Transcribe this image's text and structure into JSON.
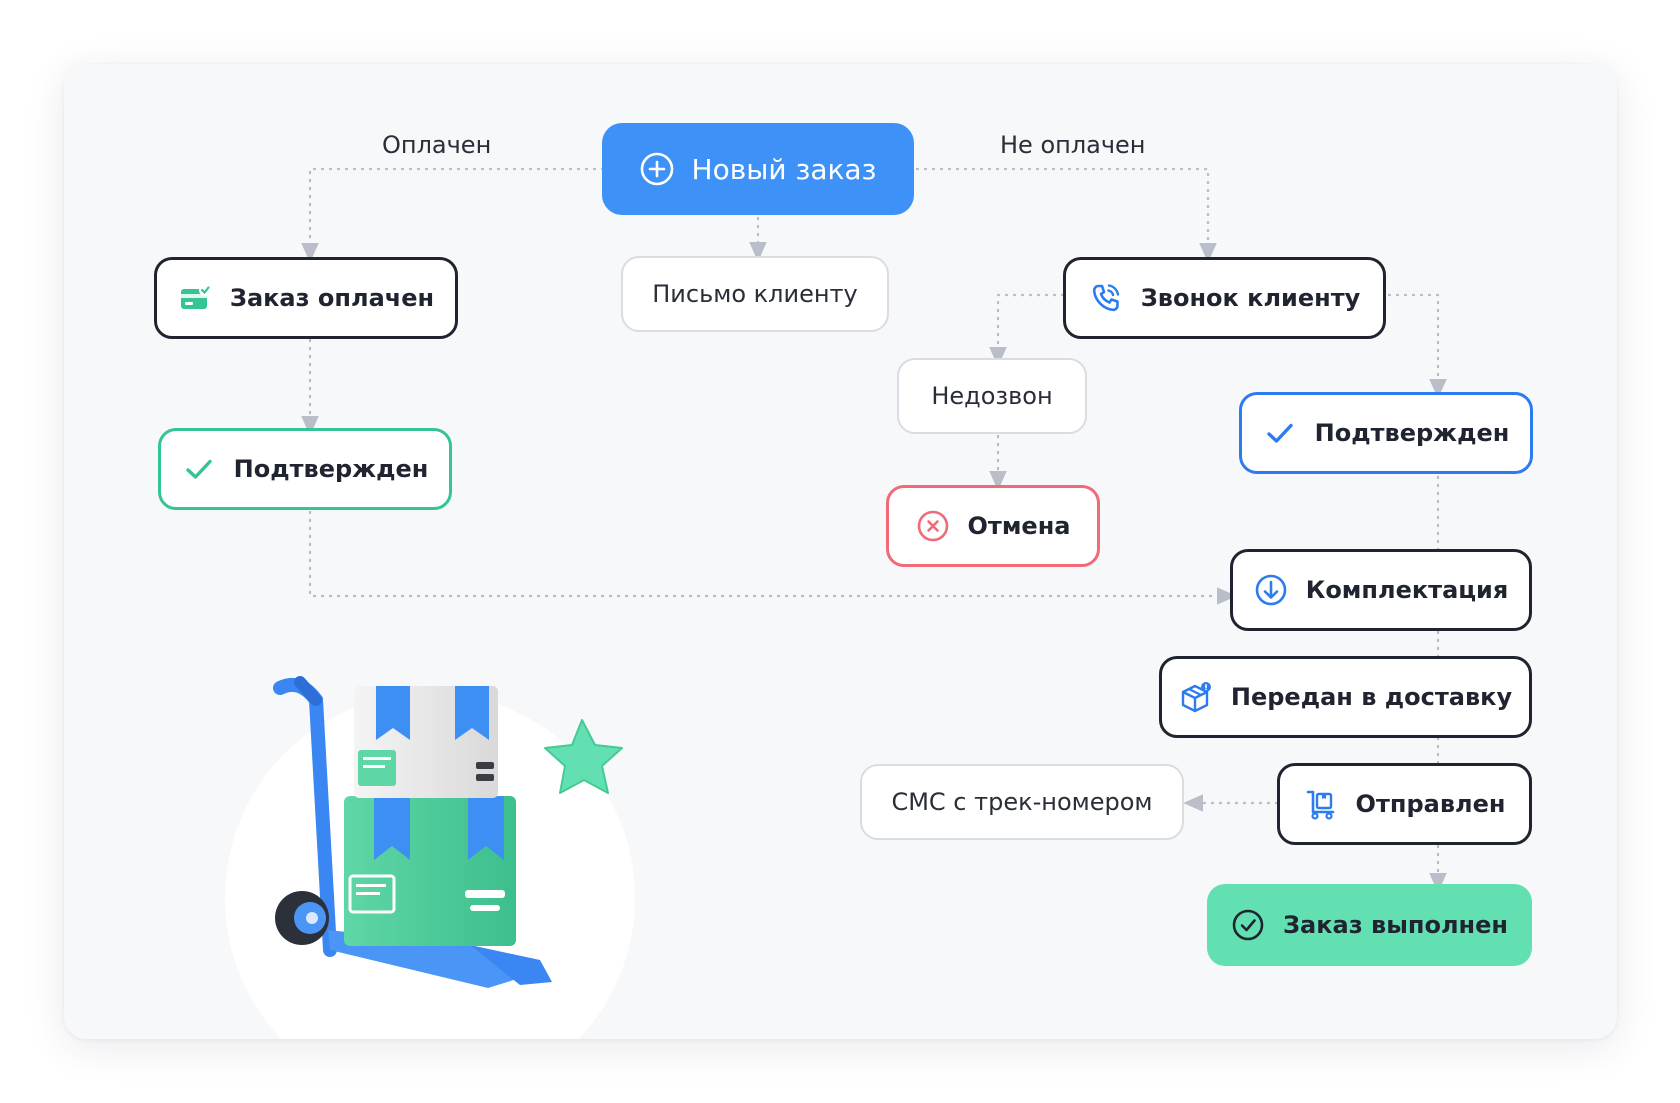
{
  "labels": {
    "paid": "Оплачен",
    "unpaid": "Не оплачен"
  },
  "nodes": {
    "new_order": "Новый заказ",
    "order_paid": "Заказ оплачен",
    "letter": "Письмо клиенту",
    "call": "Звонок клиенту",
    "no_answer": "Недозвон",
    "confirmed_left": "Подтвержден",
    "confirmed_right": "Подтвержден",
    "cancel": "Отмена",
    "picking": "Комплектация",
    "delivery": "Передан в доставку",
    "sms": "СМС с трек-номером",
    "sent": "Отправлен",
    "completed": "Заказ выполнен"
  },
  "colors": {
    "primary": "#3e92f7",
    "accent_blue": "#2c7cf0",
    "green": "#35c493",
    "done": "#63e0b1",
    "red": "#f06a78",
    "dark": "#1f2430"
  }
}
